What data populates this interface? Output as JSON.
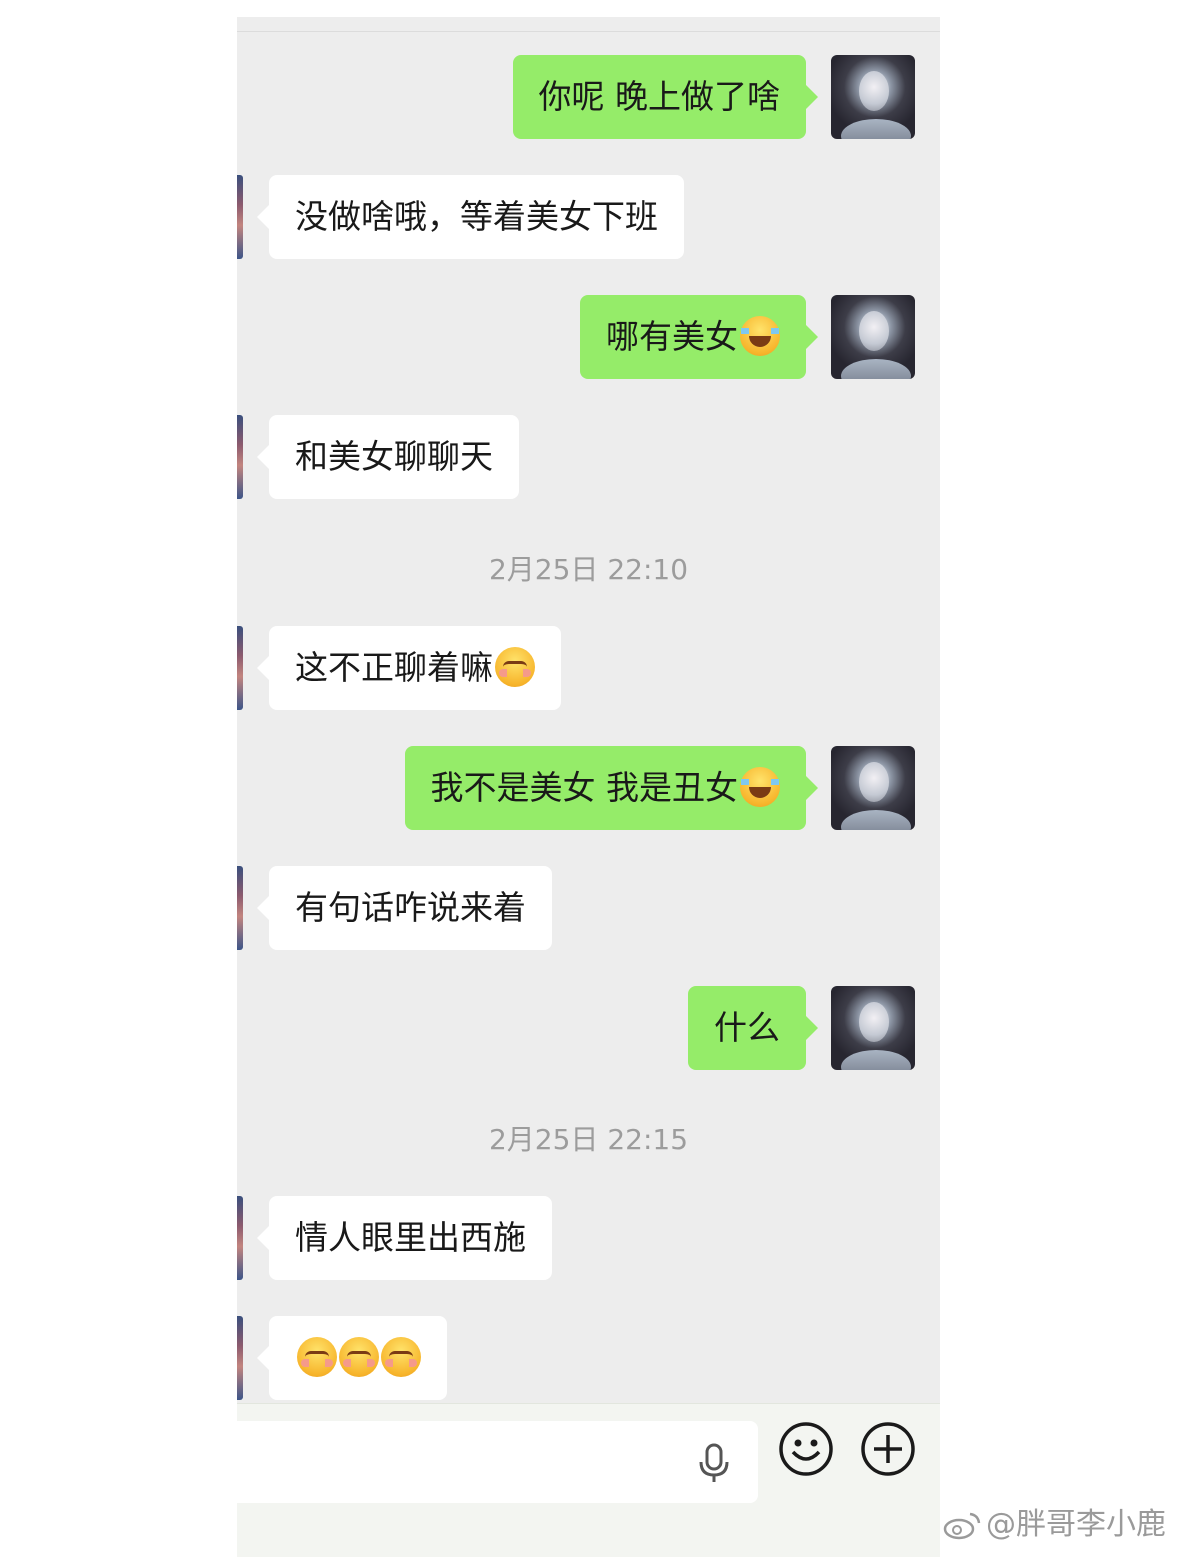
{
  "messages": [
    {
      "side": "out",
      "text": "你呢 晚上做了啥",
      "emoji": ""
    },
    {
      "side": "in",
      "text": "没做啥哦，等着美女下班",
      "emoji": ""
    },
    {
      "side": "out",
      "text": "哪有美女",
      "emoji": "laugh"
    },
    {
      "side": "in",
      "text": "和美女聊聊天",
      "emoji": ""
    },
    {
      "side": "in",
      "text": "这不正聊着嘛",
      "emoji": "shy"
    },
    {
      "side": "out",
      "text": "我不是美女 我是丑女",
      "emoji": "laugh"
    },
    {
      "side": "in",
      "text": "有句话咋说来着",
      "emoji": ""
    },
    {
      "side": "out",
      "text": "什么",
      "emoji": ""
    },
    {
      "side": "in",
      "text": "情人眼里出西施",
      "emoji": ""
    },
    {
      "side": "in",
      "text": "",
      "emoji": "shy-x3"
    }
  ],
  "timestamps": [
    "2月25日 22:10",
    "2月25日 22:15"
  ],
  "input_bar": {
    "icons": [
      "microphone-icon",
      "emoji-icon",
      "plus-icon"
    ]
  },
  "watermark": {
    "text": "@胖哥李小鹿",
    "icon": "weibo-icon"
  },
  "colors": {
    "background": "#ededed",
    "outgoing_bubble": "#95ec69",
    "incoming_bubble": "#ffffff",
    "timestamp_text": "#9c9c9c"
  }
}
